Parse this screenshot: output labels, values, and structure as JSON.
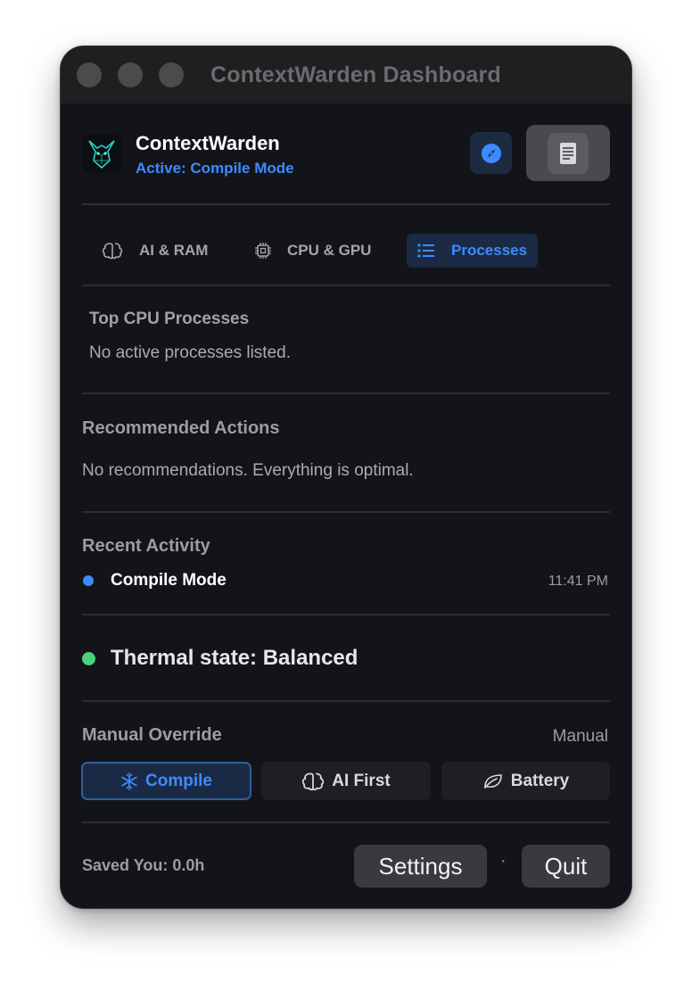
{
  "window": {
    "title": "ContextWarden Dashboard"
  },
  "header": {
    "app_name": "ContextWarden",
    "status": "Active: Compile Mode",
    "compass_icon": "compass-icon",
    "document_icon": "document-icon"
  },
  "tabs": [
    {
      "label": "AI & RAM",
      "icon": "brain-icon"
    },
    {
      "label": "CPU & GPU",
      "icon": "chip-icon"
    },
    {
      "label": "Processes",
      "icon": "list-icon",
      "active": true
    }
  ],
  "processes": {
    "title": "Top CPU Processes",
    "empty_text": "No active processes listed."
  },
  "recommendations": {
    "title": "Recommended Actions",
    "text": "No recommendations. Everything is optimal."
  },
  "activity": {
    "title": "Recent Activity",
    "items": [
      {
        "name": "Compile Mode",
        "time": "11:41 PM",
        "dot_color": "#3d8bff"
      }
    ]
  },
  "thermal": {
    "text": "Thermal state: Balanced",
    "dot_color": "#4cd07d"
  },
  "override": {
    "title": "Manual Override",
    "mode": "Manual",
    "buttons": [
      {
        "label": "Compile",
        "icon": "snowflake-icon",
        "active": true
      },
      {
        "label": "AI First",
        "icon": "brain-icon"
      },
      {
        "label": "Battery",
        "icon": "leaf-icon"
      }
    ]
  },
  "footer": {
    "saved": "Saved You: 0.0h",
    "settings_label": "Settings",
    "separator": "·",
    "quit_label": "Quit"
  },
  "colors": {
    "accent": "#3d8bff",
    "background": "#12141a",
    "success": "#4cd07d"
  }
}
